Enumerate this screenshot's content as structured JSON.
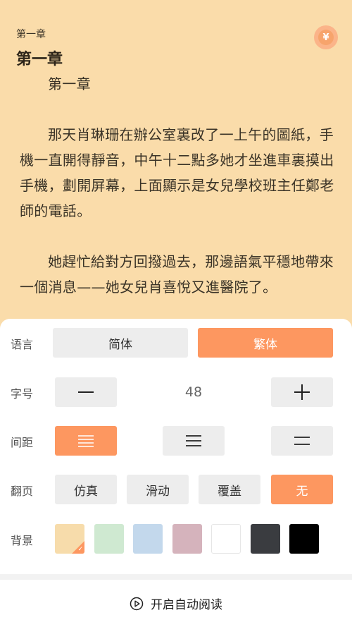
{
  "reader": {
    "chapter_small": "第一章",
    "chapter_title": "第一章",
    "paragraphs": [
      "第一章",
      "那天肖琳珊在辦公室裏改了一上午的圖紙，手機一直開得靜音，中午十二點多她才坐進車裏摸出手機，劃開屏幕，上面顯示是女兒學校班主任鄭老師的電話。",
      "她趕忙給對方回撥過去，那邊語氣平穩地帶來一個消息——她女兒肖喜悅又進醫院了。"
    ],
    "coin_icon": "¥"
  },
  "settings": {
    "language": {
      "label": "语言",
      "options": [
        "简体",
        "繁体"
      ],
      "selected": "繁体"
    },
    "font_size": {
      "label": "字号",
      "value": "48",
      "decrease_icon": "minus-icon",
      "increase_icon": "plus-icon"
    },
    "spacing": {
      "label": "间距",
      "options": [
        "compact-lines-icon",
        "medium-lines-icon",
        "wide-lines-icon"
      ],
      "selected_index": 0
    },
    "page_turn": {
      "label": "翻页",
      "options": [
        "仿真",
        "滑动",
        "覆盖",
        "无"
      ],
      "selected": "无"
    },
    "background": {
      "label": "背景",
      "colors": [
        "#f7dcab",
        "#cfe9d1",
        "#c3d8ec",
        "#d5b3bc",
        "#ffffff",
        "#3a3c40",
        "#000000"
      ],
      "selected_index": 0
    },
    "auto_read": {
      "label": "开启自动阅读",
      "icon": "play-circle-icon"
    }
  },
  "theme": {
    "accent": "#fd9760",
    "button_bg": "#ededed"
  }
}
